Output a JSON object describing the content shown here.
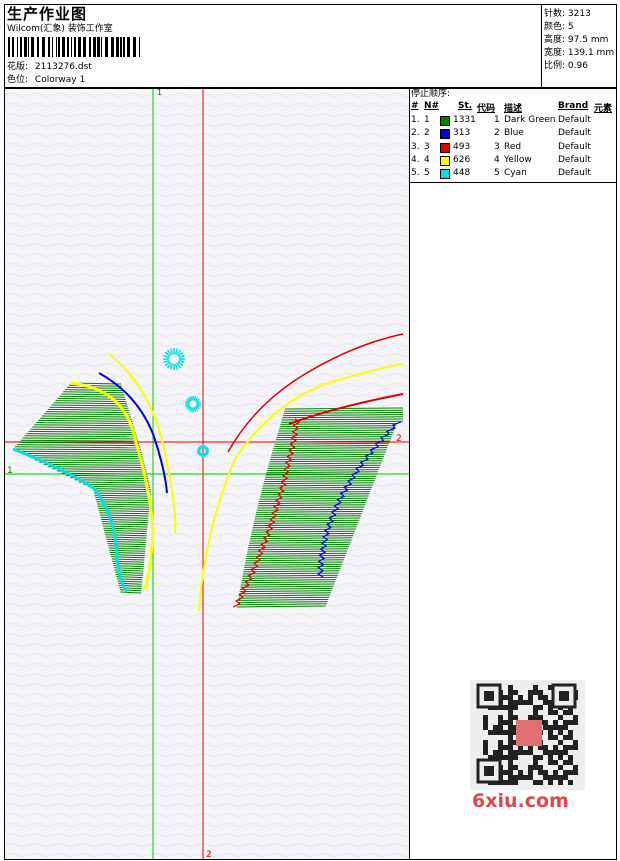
{
  "header": {
    "title": "生产作业图",
    "studio": "Wilcom(汇象) 装饰工作室",
    "design_label": "花版:",
    "design_file": "2113276.dst",
    "colorway_label": "色位:",
    "colorway": "Colorway 1"
  },
  "stats": [
    {
      "label": "针数:",
      "value": "3213"
    },
    {
      "label": "颜色:",
      "value": "5"
    },
    {
      "label": "高度:",
      "value": "97.5 mm"
    },
    {
      "label": "宽度:",
      "value": "139.1 mm"
    },
    {
      "label": "比例:",
      "value": "0.96"
    }
  ],
  "stop_sequence": {
    "label": "停止顺序:",
    "headers": {
      "num": "#",
      "n": "N#",
      "stitches": "St.",
      "code": "代码",
      "desc": "描述",
      "brand": "Brand",
      "element": "元素"
    },
    "rows": [
      {
        "num": "1.",
        "n": "1",
        "color": "#008000",
        "stitches": "1331",
        "code": "1",
        "desc": "Dark Green",
        "brand": "Default"
      },
      {
        "num": "2.",
        "n": "2",
        "color": "#0000e0",
        "stitches": "313",
        "code": "2",
        "desc": "Blue",
        "brand": "Default"
      },
      {
        "num": "3.",
        "n": "3",
        "color": "#e00000",
        "stitches": "493",
        "code": "3",
        "desc": "Red",
        "brand": "Default"
      },
      {
        "num": "4.",
        "n": "4",
        "color": "#ffff00",
        "stitches": "626",
        "code": "4",
        "desc": "Yellow",
        "brand": "Default"
      },
      {
        "num": "5.",
        "n": "5",
        "color": "#00e0e0",
        "stitches": "448",
        "code": "5",
        "desc": "Cyan",
        "brand": "Default"
      }
    ]
  },
  "guides": {
    "vertical_green": "1",
    "vertical_red": "2",
    "horizontal_green": "1",
    "horizontal_red": "2"
  },
  "colors": {
    "green": "#008000",
    "blue": "#0000e0",
    "red": "#e00000",
    "yellow": "#ffff00",
    "cyan": "#00e0e0",
    "guide_green": "#00cc00",
    "guide_red": "#e00000"
  },
  "watermark": "6xiu.com"
}
